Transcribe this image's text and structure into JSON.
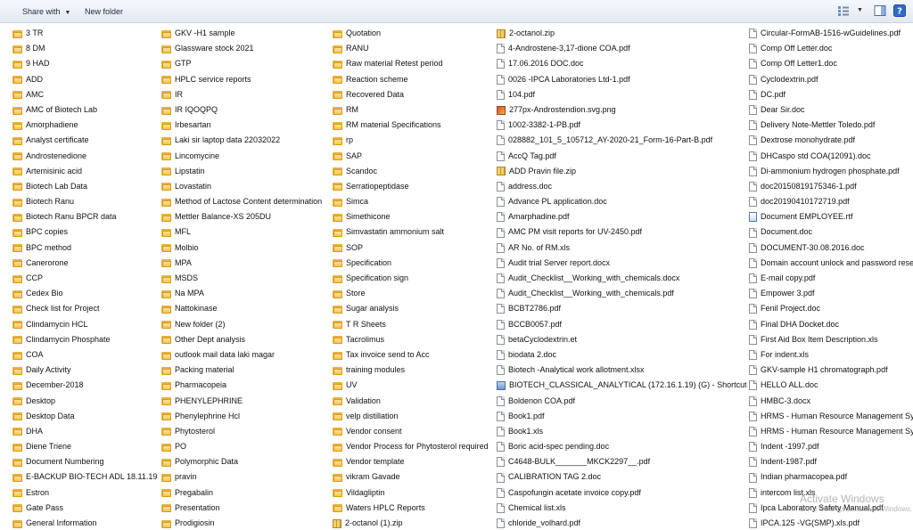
{
  "toolbar": {
    "share_label": "Share with",
    "new_folder_label": "New folder",
    "views_icon": "views-icon",
    "preview_pane_icon": "preview-pane-icon",
    "help_icon": "help-icon"
  },
  "columns": [
    {
      "items": [
        {
          "name": "3 TR",
          "type": "folder"
        },
        {
          "name": "8 DM",
          "type": "folder"
        },
        {
          "name": "9 HAD",
          "type": "folder"
        },
        {
          "name": "ADD",
          "type": "folder"
        },
        {
          "name": "AMC",
          "type": "folder"
        },
        {
          "name": "AMC of Biotech Lab",
          "type": "folder"
        },
        {
          "name": "Amorphadiene",
          "type": "folder"
        },
        {
          "name": "Analyst certificate",
          "type": "folder"
        },
        {
          "name": "Androstenedione",
          "type": "folder"
        },
        {
          "name": "Artemisinic acid",
          "type": "folder"
        },
        {
          "name": "Biotech Lab Data",
          "type": "folder"
        },
        {
          "name": "Biotech Ranu",
          "type": "folder"
        },
        {
          "name": "Biotech Ranu BPCR data",
          "type": "folder"
        },
        {
          "name": "BPC copies",
          "type": "folder"
        },
        {
          "name": "BPC method",
          "type": "folder"
        },
        {
          "name": "Canerorone",
          "type": "folder"
        },
        {
          "name": "CCP",
          "type": "folder"
        },
        {
          "name": "Cedex Bio",
          "type": "folder"
        },
        {
          "name": "Check list for Project",
          "type": "folder"
        },
        {
          "name": "Clindamycin HCL",
          "type": "folder"
        },
        {
          "name": "Clindamycin Phosphate",
          "type": "folder"
        },
        {
          "name": "COA",
          "type": "folder"
        },
        {
          "name": "Daily Activity",
          "type": "folder"
        },
        {
          "name": "December-2018",
          "type": "folder"
        },
        {
          "name": "Desktop",
          "type": "folder"
        },
        {
          "name": "Desktop Data",
          "type": "folder"
        },
        {
          "name": "DHA",
          "type": "folder"
        },
        {
          "name": "Diene Triene",
          "type": "folder"
        },
        {
          "name": "Document Numbering",
          "type": "folder"
        },
        {
          "name": "E-BACKUP BIO-TECH ADL 18.11.19",
          "type": "folder"
        },
        {
          "name": "Estron",
          "type": "folder"
        },
        {
          "name": "Gate Pass",
          "type": "folder"
        },
        {
          "name": "General Information",
          "type": "folder"
        }
      ]
    },
    {
      "items": [
        {
          "name": "GKV -H1 sample",
          "type": "folder"
        },
        {
          "name": "Glassware stock 2021",
          "type": "folder"
        },
        {
          "name": "GTP",
          "type": "folder"
        },
        {
          "name": "HPLC service reports",
          "type": "folder"
        },
        {
          "name": "IR",
          "type": "folder"
        },
        {
          "name": "IR IQOQPQ",
          "type": "folder"
        },
        {
          "name": "Irbesartan",
          "type": "folder"
        },
        {
          "name": "Laki sir laptop data 22032022",
          "type": "folder"
        },
        {
          "name": "Lincomycine",
          "type": "folder"
        },
        {
          "name": "Lipstatin",
          "type": "folder"
        },
        {
          "name": "Lovastatin",
          "type": "folder"
        },
        {
          "name": "Method of Lactose Content determination",
          "type": "folder"
        },
        {
          "name": "Mettler Balance-XS 205DU",
          "type": "folder"
        },
        {
          "name": "MFL",
          "type": "folder"
        },
        {
          "name": "Molbio",
          "type": "folder"
        },
        {
          "name": "MPA",
          "type": "folder"
        },
        {
          "name": "MSDS",
          "type": "folder"
        },
        {
          "name": "Na MPA",
          "type": "folder"
        },
        {
          "name": "Nattokinase",
          "type": "folder"
        },
        {
          "name": "New folder (2)",
          "type": "folder"
        },
        {
          "name": "Other Dept analysis",
          "type": "folder"
        },
        {
          "name": "outlook mail data laki magar",
          "type": "folder"
        },
        {
          "name": "Packing material",
          "type": "folder"
        },
        {
          "name": "Pharmacopeia",
          "type": "folder"
        },
        {
          "name": "PHENYLEPHRINE",
          "type": "folder"
        },
        {
          "name": "Phenylephrine Hcl",
          "type": "folder"
        },
        {
          "name": "Phytosterol",
          "type": "folder"
        },
        {
          "name": "PO",
          "type": "folder"
        },
        {
          "name": "Polymorphic Data",
          "type": "folder"
        },
        {
          "name": "pravin",
          "type": "folder"
        },
        {
          "name": "Pregabalin",
          "type": "folder"
        },
        {
          "name": "Presentation",
          "type": "folder"
        },
        {
          "name": "Prodigiosin",
          "type": "folder"
        }
      ]
    },
    {
      "items": [
        {
          "name": "Quotation",
          "type": "folder"
        },
        {
          "name": "RANU",
          "type": "folder"
        },
        {
          "name": "Raw material Retest period",
          "type": "folder"
        },
        {
          "name": "Reaction scheme",
          "type": "folder"
        },
        {
          "name": "Recovered Data",
          "type": "folder"
        },
        {
          "name": "RM",
          "type": "folder"
        },
        {
          "name": "RM material Specifications",
          "type": "folder"
        },
        {
          "name": "rp",
          "type": "folder"
        },
        {
          "name": "SAP",
          "type": "folder"
        },
        {
          "name": "Scandoc",
          "type": "folder"
        },
        {
          "name": "Serratiopeptidase",
          "type": "folder"
        },
        {
          "name": "Simca",
          "type": "folder"
        },
        {
          "name": "Simethicone",
          "type": "folder"
        },
        {
          "name": "Simvastatin ammonium salt",
          "type": "folder"
        },
        {
          "name": "SOP",
          "type": "folder"
        },
        {
          "name": "Specification",
          "type": "folder"
        },
        {
          "name": "Specification sign",
          "type": "folder"
        },
        {
          "name": "Store",
          "type": "folder"
        },
        {
          "name": "Sugar analysis",
          "type": "folder"
        },
        {
          "name": "T R Sheets",
          "type": "folder"
        },
        {
          "name": "Tacrolimus",
          "type": "folder"
        },
        {
          "name": "Tax invoice send to Acc",
          "type": "folder"
        },
        {
          "name": "training modules",
          "type": "folder"
        },
        {
          "name": "UV",
          "type": "folder"
        },
        {
          "name": "Validation",
          "type": "folder"
        },
        {
          "name": "velp distillation",
          "type": "folder"
        },
        {
          "name": "Vendor consent",
          "type": "folder"
        },
        {
          "name": "Vendor Process for Phytosterol required",
          "type": "folder"
        },
        {
          "name": "Vendor template",
          "type": "folder"
        },
        {
          "name": "vikram Gavade",
          "type": "folder"
        },
        {
          "name": "Vildagliptin",
          "type": "folder"
        },
        {
          "name": "Waters HPLC Reports",
          "type": "folder"
        },
        {
          "name": "2-octanol (1).zip",
          "type": "zip"
        }
      ]
    },
    {
      "items": [
        {
          "name": "2-octanol.zip",
          "type": "zip"
        },
        {
          "name": "4-Androstene-3,17-dione COA.pdf",
          "type": "file"
        },
        {
          "name": "17.06.2016 DOC.doc",
          "type": "file"
        },
        {
          "name": "0026 -IPCA Laboratories Ltd-1.pdf",
          "type": "file"
        },
        {
          "name": "104.pdf",
          "type": "file"
        },
        {
          "name": "277px-Androstendion.svg.png",
          "type": "image"
        },
        {
          "name": "1002-3382-1-PB.pdf",
          "type": "file"
        },
        {
          "name": "028882_101_5_105712_AY-2020-21_Form-16-Part-B.pdf",
          "type": "file"
        },
        {
          "name": "AccQ Tag.pdf",
          "type": "file"
        },
        {
          "name": "ADD Pravin file.zip",
          "type": "zip"
        },
        {
          "name": "address.doc",
          "type": "file"
        },
        {
          "name": "Advance PL application.doc",
          "type": "file"
        },
        {
          "name": "Amarphadine.pdf",
          "type": "file"
        },
        {
          "name": "AMC PM visit reports for UV-2450.pdf",
          "type": "file"
        },
        {
          "name": "AR No. of RM.xls",
          "type": "file"
        },
        {
          "name": "Audit trial Server report.docx",
          "type": "file"
        },
        {
          "name": "Audit_Checklist__Working_with_chemicals.docx",
          "type": "file"
        },
        {
          "name": "Audit_Checklist__Working_with_chemicals.pdf",
          "type": "file"
        },
        {
          "name": "BCBT2786.pdf",
          "type": "file"
        },
        {
          "name": "BCCB0057.pdf",
          "type": "file"
        },
        {
          "name": "betaCyclodextrin.et",
          "type": "file"
        },
        {
          "name": "biodata 2.doc",
          "type": "file"
        },
        {
          "name": "Biotech -Analytical work allotment.xlsx",
          "type": "file"
        },
        {
          "name": "BIOTECH_CLASSICAL_ANALYTICAL (172.16.1.19) (G) - Shortcut",
          "type": "shortcut"
        },
        {
          "name": "Boldenon COA.pdf",
          "type": "file"
        },
        {
          "name": "Book1.pdf",
          "type": "file"
        },
        {
          "name": "Book1.xls",
          "type": "file"
        },
        {
          "name": "Boric acid-spec pending.doc",
          "type": "file"
        },
        {
          "name": "C4648-BULK_______MKCK2297__.pdf",
          "type": "file"
        },
        {
          "name": "CALIBRATION TAG 2.doc",
          "type": "file"
        },
        {
          "name": "Caspofungin acetate invoice copy.pdf",
          "type": "file"
        },
        {
          "name": "Chemical list.xls",
          "type": "file"
        },
        {
          "name": "chloride_volhard.pdf",
          "type": "file"
        }
      ]
    },
    {
      "items": [
        {
          "name": "Circular-FormAB-1516-wGuidelines.pdf",
          "type": "file"
        },
        {
          "name": "Comp Off Letter.doc",
          "type": "file"
        },
        {
          "name": "Comp Off Letter1.doc",
          "type": "file"
        },
        {
          "name": "Cyclodextrin.pdf",
          "type": "file"
        },
        {
          "name": "DC.pdf",
          "type": "file"
        },
        {
          "name": "Dear Sir.doc",
          "type": "file"
        },
        {
          "name": "Delivery Note-Mettler Toledo.pdf",
          "type": "file"
        },
        {
          "name": "Dextrose monohydrate.pdf",
          "type": "file"
        },
        {
          "name": "DHCaspo std COA(12091).doc",
          "type": "file"
        },
        {
          "name": "Di-ammonium hydrogen phosphate.pdf",
          "type": "file"
        },
        {
          "name": "doc20150819175346-1.pdf",
          "type": "file"
        },
        {
          "name": "doc20190410172719.pdf",
          "type": "file"
        },
        {
          "name": "Document EMPLOYEE.rtf",
          "type": "rtf"
        },
        {
          "name": "Document.doc",
          "type": "file"
        },
        {
          "name": "DOCUMENT-30.08.2016.doc",
          "type": "file"
        },
        {
          "name": "Domain account unlock and password reset",
          "type": "file"
        },
        {
          "name": "E-mail copy.pdf",
          "type": "file"
        },
        {
          "name": "Empower 3.pdf",
          "type": "file"
        },
        {
          "name": "Fenil Project.doc",
          "type": "file"
        },
        {
          "name": "Final DHA Docket.doc",
          "type": "file"
        },
        {
          "name": "First Aid Box Item Description.xls",
          "type": "file"
        },
        {
          "name": "For indent.xls",
          "type": "file"
        },
        {
          "name": "GKV-sample H1 chromatograph.pdf",
          "type": "file"
        },
        {
          "name": "HELLO ALL.doc",
          "type": "file"
        },
        {
          "name": "HMBC-3.docx",
          "type": "file"
        },
        {
          "name": "HRMS - Human Resource Management Syste",
          "type": "file"
        },
        {
          "name": "HRMS - Human Resource Management Syste",
          "type": "file"
        },
        {
          "name": "Indent -1997.pdf",
          "type": "file"
        },
        {
          "name": "Indent-1987.pdf",
          "type": "file"
        },
        {
          "name": "Indian pharmacopea.pdf",
          "type": "file"
        },
        {
          "name": "intercom list.xls",
          "type": "file"
        },
        {
          "name": "Ipca Laboratory Safety Manual.pdf",
          "type": "file"
        },
        {
          "name": "IPCA.125 -VG(SMP).xls.pdf",
          "type": "file"
        }
      ]
    }
  ],
  "watermark": {
    "title": "Activate Windows",
    "subtitle": "Go to Settings to activate Windows."
  }
}
